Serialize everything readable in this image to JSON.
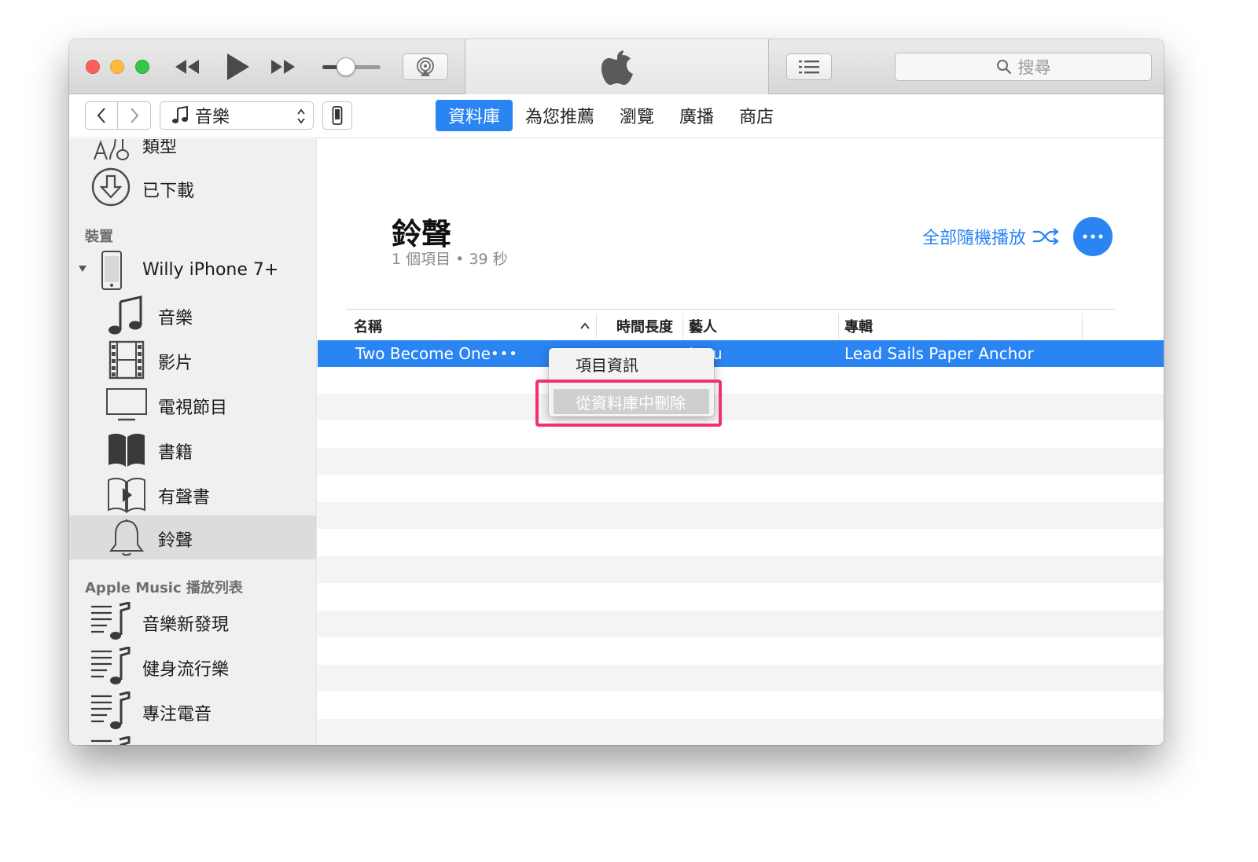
{
  "search": {
    "placeholder": "搜尋"
  },
  "navbar": {
    "media_type": "音樂",
    "tabs": [
      {
        "label": "資料庫",
        "active": true
      },
      {
        "label": "為您推薦",
        "active": false
      },
      {
        "label": "瀏覽",
        "active": false
      },
      {
        "label": "廣播",
        "active": false
      },
      {
        "label": "商店",
        "active": false
      }
    ]
  },
  "sidebar": {
    "library_items": [
      {
        "label": "類型",
        "icon": "genre-icon"
      },
      {
        "label": "已下載",
        "icon": "download-icon"
      }
    ],
    "devices_header": "裝置",
    "device_name": "Willy  iPhone 7+",
    "device_items": [
      {
        "label": "音樂",
        "icon": "music-note-icon"
      },
      {
        "label": "影片",
        "icon": "film-icon"
      },
      {
        "label": "電視節目",
        "icon": "tv-icon"
      },
      {
        "label": "書籍",
        "icon": "book-icon"
      },
      {
        "label": "有聲書",
        "icon": "audiobook-icon"
      },
      {
        "label": "鈴聲",
        "icon": "bell-icon",
        "selected": true
      }
    ],
    "playlists_header": "Apple Music 播放列表",
    "playlists": [
      {
        "label": "音樂新發現",
        "icon": "playlist-icon"
      },
      {
        "label": "健身流行樂",
        "icon": "playlist-icon"
      },
      {
        "label": "專注電音",
        "icon": "playlist-icon"
      }
    ]
  },
  "main": {
    "title": "鈴聲",
    "subtitle": "1 個項目 • 39 秒",
    "shuffle_label": "全部隨機播放",
    "columns": [
      "名稱",
      "時間長度",
      "藝人",
      "專輯"
    ],
    "rows": [
      {
        "name": "Two Become One",
        "more": "•••",
        "artist": "Jeyu",
        "album": "Lead Sails Paper Anchor"
      }
    ]
  },
  "context_menu": {
    "items": [
      "項目資訊",
      "從資料庫中刪除"
    ]
  },
  "colors": {
    "accent": "#2a84f2",
    "highlight": "#f2306d",
    "sidebar_bg": "#f0f0f0"
  }
}
